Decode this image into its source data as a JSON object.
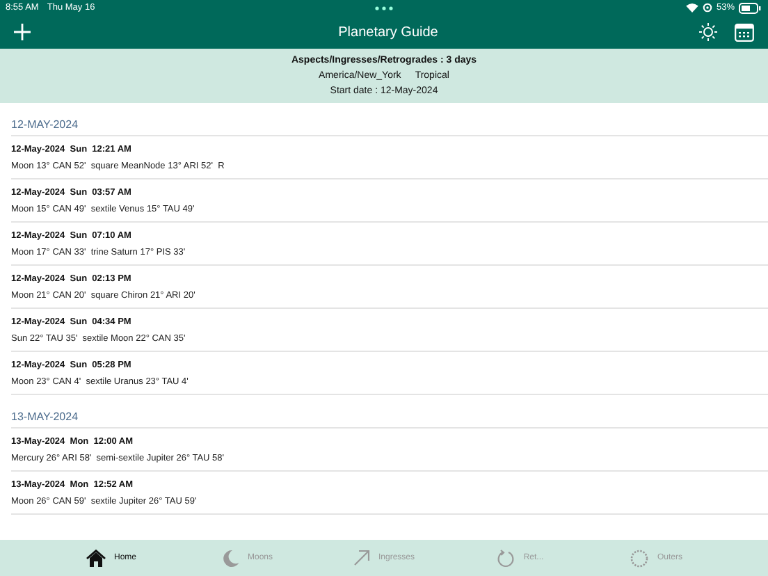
{
  "status_bar": {
    "time": "8:55 AM",
    "date": "Thu May 16",
    "battery": "53%"
  },
  "nav_bar": {
    "title": "Planetary Guide"
  },
  "info": {
    "heading": "Aspects/Ingresses/Retrogrades : 3 days",
    "timezone": "America/New_York",
    "zodiac": "Tropical",
    "start_date": "Start date : 12-May-2024"
  },
  "days": [
    {
      "date": "12-MAY-2024",
      "events": [
        {
          "time": "12-May-2024  Sun  12:21 AM",
          "text": "Moon 13° CAN 52'  square MeanNode 13° ARI 52'  R"
        },
        {
          "time": "12-May-2024  Sun  03:57 AM",
          "text": "Moon 15° CAN 49'  sextile Venus 15° TAU 49'"
        },
        {
          "time": "12-May-2024  Sun  07:10 AM",
          "text": "Moon 17° CAN 33'  trine Saturn 17° PIS 33'"
        },
        {
          "time": "12-May-2024  Sun  02:13 PM",
          "text": "Moon 21° CAN 20'  square Chiron 21° ARI 20'"
        },
        {
          "time": "12-May-2024  Sun  04:34 PM",
          "text": "Sun 22° TAU 35'  sextile Moon 22° CAN 35'"
        },
        {
          "time": "12-May-2024  Sun  05:28 PM",
          "text": "Moon 23° CAN 4'  sextile Uranus 23° TAU 4'"
        }
      ]
    },
    {
      "date": "13-MAY-2024",
      "events": [
        {
          "time": "13-May-2024  Mon  12:00 AM",
          "text": "Mercury 26° ARI 58'  semi-sextile Jupiter 26° TAU 58'"
        },
        {
          "time": "13-May-2024  Mon  12:52 AM",
          "text": "Moon 26° CAN 59'  sextile Jupiter 26° TAU 59'"
        }
      ]
    }
  ],
  "tab_bar": [
    {
      "label": "Home",
      "kind": "home",
      "selected": true
    },
    {
      "label": "Moons",
      "kind": "moon",
      "selected": false
    },
    {
      "label": "Ingresses",
      "kind": "arrow",
      "selected": false
    },
    {
      "label": "Ret...",
      "kind": "cycle",
      "selected": false
    },
    {
      "label": "Outers",
      "kind": "ring",
      "selected": false
    }
  ]
}
